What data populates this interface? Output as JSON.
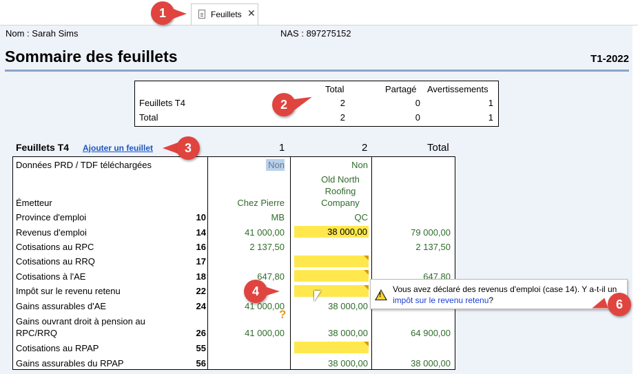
{
  "tab": {
    "label": "Feuillets",
    "close": "✕"
  },
  "header": {
    "name": "Nom : Sarah Sims",
    "nas": "NAS : 897275152",
    "title": "Sommaire des feuillets",
    "year": "T1-2022"
  },
  "summary": {
    "headers": [
      "Total",
      "Partagé",
      "Avertissements"
    ],
    "rows": [
      {
        "label": "Feuillets T4",
        "total": "2",
        "shared": "0",
        "warnings": "1"
      },
      {
        "label": "Total",
        "total": "2",
        "shared": "0",
        "warnings": "1"
      }
    ]
  },
  "t4": {
    "title": "Feuillets T4",
    "add_link": "Ajouter un feuillet",
    "col_headers": [
      "1",
      "2",
      "Total"
    ],
    "rows": [
      {
        "label": "Données PRD /  TDF téléchargées",
        "code": "",
        "c1": "Non",
        "c2": "Non",
        "total": ""
      },
      {
        "label": "Émetteur",
        "code": "",
        "c1": "Chez Pierre",
        "c2": "Old North Roofing Company",
        "total": ""
      },
      {
        "label": "Province d'emploi",
        "code": "10",
        "c1": "MB",
        "c2": "QC",
        "total": ""
      },
      {
        "label": "Revenus d'emploi",
        "code": "14",
        "c1": "41 000,00",
        "c2": "38 000,00",
        "total": "79 000,00"
      },
      {
        "label": "Cotisations au RPC",
        "code": "16",
        "c1": "2 137,50",
        "c2": "",
        "total": "2 137,50"
      },
      {
        "label": "Cotisations au RRQ",
        "code": "17",
        "c1": "",
        "c2": "",
        "total": ""
      },
      {
        "label": "Cotisations à l'AE",
        "code": "18",
        "c1": "647,80",
        "c2": "",
        "total": "647,80"
      },
      {
        "label": "Impôt sur le revenu retenu",
        "code": "22",
        "c1": "",
        "c2": "",
        "total": ""
      },
      {
        "label": "Gains assurables d'AE",
        "code": "24",
        "c1": "41 000,00",
        "c2": "38 000,00",
        "total": ""
      },
      {
        "label": "Gains ouvrant droit à pension au RPC/RRQ",
        "code": "26",
        "c1": "41 000,00",
        "c2": "38 000,00",
        "total": "64 900,00"
      },
      {
        "label": "Cotisations au RPAP",
        "code": "55",
        "c1": "",
        "c2": "",
        "total": ""
      },
      {
        "label": "Gains assurables du RPAP",
        "code": "56",
        "c1": "",
        "c2": "38 000,00",
        "total": "38 000,00"
      }
    ]
  },
  "tooltip": {
    "text_before": "Vous avez déclaré des revenus d'emploi (case 14). Y a-t-il un ",
    "link": "impôt sur le revenu retenu",
    "text_after": "?"
  },
  "callouts": [
    "1",
    "2",
    "3",
    "4",
    "6"
  ],
  "colors": {
    "callout": "#e0443f",
    "value_green": "#2f6b2a",
    "highlight_yellow": "#ffe84d",
    "link_blue": "#1a56c4"
  }
}
